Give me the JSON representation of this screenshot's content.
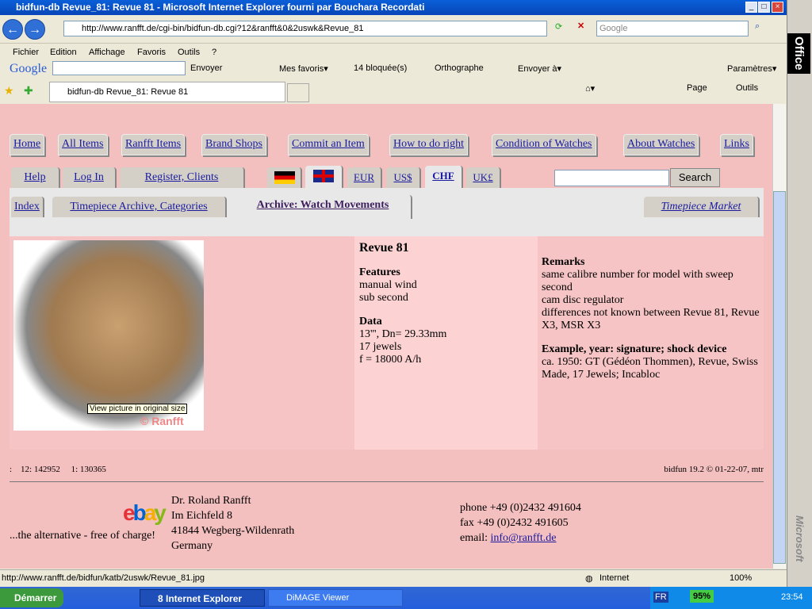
{
  "window": {
    "title": "bidfun-db Revue_81: Revue 81 - Microsoft Internet Explorer fourni par Bouchara Recordati"
  },
  "address": {
    "url": "http://www.ranfft.de/cgi-bin/bidfun-db.cgi?12&ranfft&0&2uswk&Revue_81",
    "search_placeholder": "Google"
  },
  "menu": [
    "Fichier",
    "Edition",
    "Affichage",
    "Favoris",
    "Outils",
    "?"
  ],
  "google_toolbar": {
    "logo": "Google",
    "send": "Envoyer",
    "favorites": "Mes favoris▾",
    "blocked": "14 bloquée(s)",
    "spelling": "Orthographe",
    "send_to": "Envoyer à▾",
    "settings": "Paramètres▾"
  },
  "tab": {
    "title": "bidfun-db Revue_81: Revue 81",
    "page": "Page",
    "tools": "Outils"
  },
  "nav": [
    "Home",
    "All Items",
    "Ranfft Items",
    "Brand Shops",
    "Commit an Item",
    "How to do right",
    "Condition of Watches",
    "About Watches",
    "Links"
  ],
  "nav2": {
    "help": "Help",
    "login": "Log In",
    "register": "Register, Clients",
    "currencies": [
      "EUR",
      "US$",
      "CHF",
      "UK£"
    ],
    "search_button": "Search"
  },
  "subnav": {
    "index": "Index",
    "archive": "Timepiece Archive, Categories",
    "movements": "Archive: Watch Movements",
    "market": "Timepiece Market"
  },
  "item": {
    "title": "Revue 81",
    "features_h": "Features",
    "features": [
      "manual wind",
      "sub second"
    ],
    "data_h": "Data",
    "data": [
      "13''', Dn= 29.33mm",
      "17 jewels",
      "f = 18000 A/h"
    ],
    "remarks_h": "Remarks",
    "remarks": [
      "same calibre number for model with sweep second",
      "cam disc regulator",
      "differences not known between Revue 81, Revue X3, MSR X3"
    ],
    "example_h": "Example, year: signature; shock device",
    "example": "ca. 1950: GT (Gédéon Thommen), Revue, Swiss Made, 17 Jewels; Incabloc",
    "tooltip": "View picture in original size",
    "watermark": "© Ranfft"
  },
  "footer": {
    "counts": ":    12: 142952     1: 130365",
    "version": "bidfun 19.2 © 01-22-07, mtr",
    "alt": "...the alternative - free of charge!",
    "logo": "ebay",
    "address": [
      "Dr. Roland Ranfft",
      "Im Eichfeld 8",
      "41844 Wegberg-Wildenrath",
      "Germany"
    ],
    "phone": "phone +49 (0)2432 491604",
    "fax": "fax +49 (0)2432 491605",
    "email_label": "email:",
    "email": "info@ranfft.de"
  },
  "status": {
    "url": "http://www.ranfft.de/bidfun/katb/2uswk/Revue_81.jpg",
    "zone": "Internet",
    "zoom": "100%"
  },
  "taskbar": {
    "start": "Démarrer",
    "ie": "8 Internet Explorer",
    "dimage": "DiMAGE Viewer",
    "lang": "FR",
    "battery": "95%",
    "time": "23:54"
  },
  "office": {
    "label": "Office",
    "brand": "Microsoft"
  }
}
